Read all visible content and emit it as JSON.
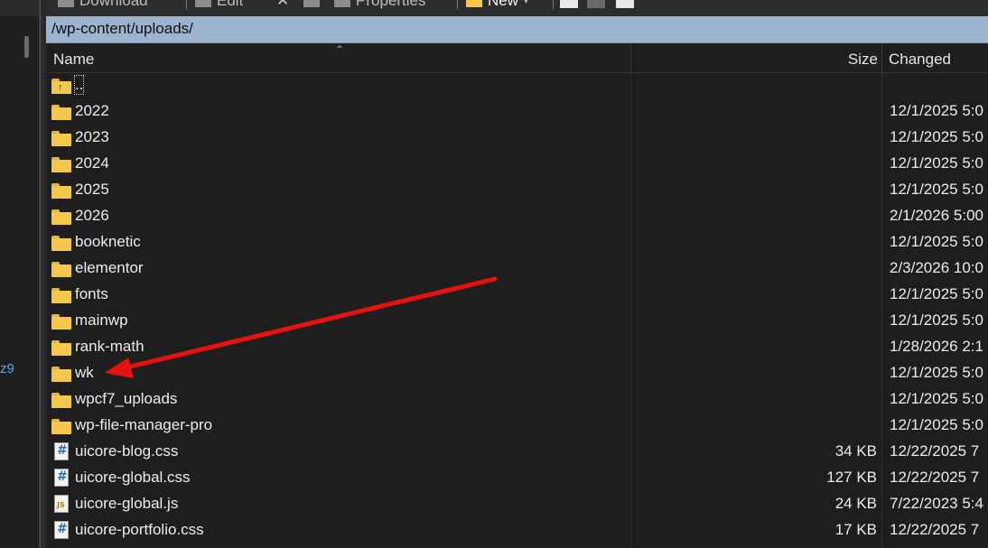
{
  "toolbar": {
    "download_label": "Download",
    "edit_label": "Edit",
    "properties_label": "Properties",
    "new_label": "New"
  },
  "path": "/wp-content/uploads/",
  "columns": {
    "name": "Name",
    "size": "Size",
    "changed": "Changed"
  },
  "left_fragment": "z9",
  "rows": [
    {
      "name": "..",
      "type": "parent",
      "size": "",
      "changed": ""
    },
    {
      "name": "2022",
      "type": "folder",
      "size": "",
      "changed": "12/1/2025 5:0"
    },
    {
      "name": "2023",
      "type": "folder",
      "size": "",
      "changed": "12/1/2025 5:0"
    },
    {
      "name": "2024",
      "type": "folder",
      "size": "",
      "changed": "12/1/2025 5:0"
    },
    {
      "name": "2025",
      "type": "folder",
      "size": "",
      "changed": "12/1/2025 5:0"
    },
    {
      "name": "2026",
      "type": "folder",
      "size": "",
      "changed": "2/1/2026 5:00"
    },
    {
      "name": "booknetic",
      "type": "folder",
      "size": "",
      "changed": "12/1/2025 5:0"
    },
    {
      "name": "elementor",
      "type": "folder",
      "size": "",
      "changed": "2/3/2026 10:0"
    },
    {
      "name": "fonts",
      "type": "folder",
      "size": "",
      "changed": "12/1/2025 5:0"
    },
    {
      "name": "mainwp",
      "type": "folder",
      "size": "",
      "changed": "12/1/2025 5:0"
    },
    {
      "name": "rank-math",
      "type": "folder",
      "size": "",
      "changed": "1/28/2026 2:1"
    },
    {
      "name": "wk",
      "type": "folder",
      "size": "",
      "changed": "12/1/2025 5:0"
    },
    {
      "name": "wpcf7_uploads",
      "type": "folder",
      "size": "",
      "changed": "12/1/2025 5:0"
    },
    {
      "name": "wp-file-manager-pro",
      "type": "folder",
      "size": "",
      "changed": "12/1/2025 5:0"
    },
    {
      "name": "uicore-blog.css",
      "type": "css",
      "size": "34 KB",
      "changed": "12/22/2025 7"
    },
    {
      "name": "uicore-global.css",
      "type": "css",
      "size": "127 KB",
      "changed": "12/22/2025 7"
    },
    {
      "name": "uicore-global.js",
      "type": "js",
      "size": "24 KB",
      "changed": "7/22/2023 5:4"
    },
    {
      "name": "uicore-portfolio.css",
      "type": "css",
      "size": "17 KB",
      "changed": "12/22/2025 7"
    }
  ],
  "annotation_arrow_color": "#e8110f",
  "colors": {
    "path_bar": "#9cb4cf",
    "folder": "#f5c84c",
    "background": "#1e1e1e"
  }
}
